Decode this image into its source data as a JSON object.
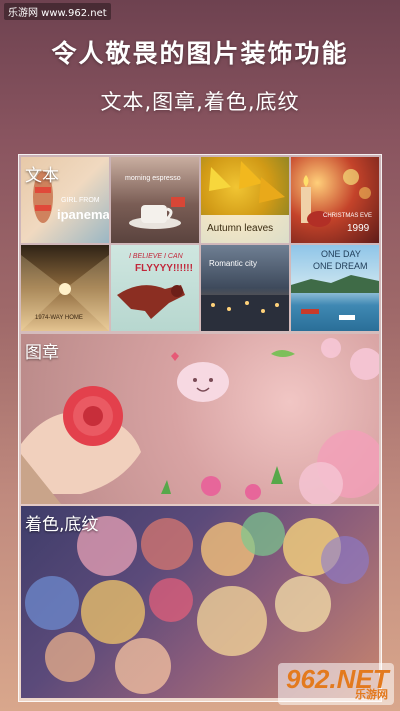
{
  "watermark_top": "乐游网 www.962.net",
  "headline": "令人敬畏的图片装饰功能",
  "subheadline": "文本,图章,着色,底纹",
  "sections": {
    "text": {
      "label": "文本"
    },
    "stamp": {
      "label": "图章"
    },
    "color": {
      "label": "着色,底纹"
    }
  },
  "tiles": {
    "t1": {
      "line1": "GIRL FROM",
      "line2": "ipanema"
    },
    "t2": {
      "line1": "morning espresso"
    },
    "t3": {
      "line1": "Autumn leaves"
    },
    "t4": {
      "line1": "CHRISTMAS EVE",
      "line2": "1999"
    },
    "t5": {
      "line1": "1974-WAY HOME"
    },
    "t6": {
      "line1": "I BELIEVE I CAN",
      "line2": "FLYYYY!!!!!!"
    },
    "t7": {
      "line1": "Romantic city"
    },
    "t8": {
      "line1": "ONE DAY",
      "line2": "ONE DREAM"
    }
  },
  "watermark_bottom": {
    "brand": "962.NET",
    "sub": "乐游网"
  },
  "colors": {
    "accent": "#e37a1e",
    "text": "#ffffff"
  }
}
